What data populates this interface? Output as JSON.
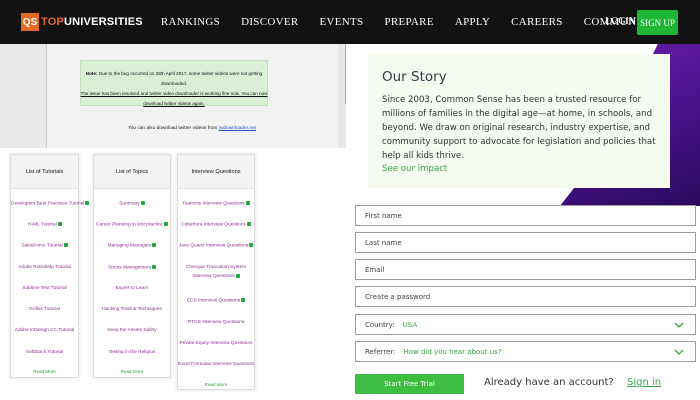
{
  "navbar": {
    "logo_box": "QS",
    "logo_text_prefix": "TOP",
    "logo_text_suffix": "UNIVERSITIES",
    "links": [
      "RANKINGS",
      "DISCOVER",
      "EVENTS",
      "PREPARE",
      "APPLY",
      "CAREERS",
      "COMMUNITY"
    ],
    "login": "LOGIN",
    "signup": "SIGN UP"
  },
  "notice": {
    "note_label": "Note:",
    "note_line1": "Due to the bug occurred on 28th April 2017, some twitter videos were not getting downloaded.",
    "note_line2": "The issue has been resolved and twitter video downloader is working fine now. You can now",
    "note_line3": "download twitter videos again.",
    "also_text": "You can also download twitter videos from",
    "also_link": "twdownloader.net"
  },
  "columns": [
    {
      "title": "List of Tutorials",
      "items": [
        {
          "label": "Developers Best Practices Tutorial",
          "badge": true
        },
        {
          "label": "YAML Tutorial",
          "badge": true
        },
        {
          "label": "SalesForce Tutorial",
          "badge": true
        },
        {
          "label": "Adobe Robohelp Tutorial",
          "badge": false
        },
        {
          "label": "Sublime Text Tutorial",
          "badge": false
        },
        {
          "label": "Grilles Tutorial",
          "badge": false
        },
        {
          "label": "Adobe InDesign CC Tutorial",
          "badge": false
        },
        {
          "label": "SaltStack Tutorial",
          "badge": false
        }
      ],
      "read_more": "Read More"
    },
    {
      "title": "List of Topics",
      "items": [
        {
          "label": "Summary",
          "badge": true
        },
        {
          "label": "Career Planning in test practice",
          "badge": true
        },
        {
          "label": "Managing Managers",
          "badge": true
        },
        {
          "label": "Stress Management",
          "badge": true
        },
        {
          "label": "Expert to Learn",
          "badge": false
        },
        {
          "label": "Hacking Tools & Techniques",
          "badge": false
        },
        {
          "label": "Keep the Assets Safely",
          "badge": false
        },
        {
          "label": "Testing in the Religion",
          "badge": false
        }
      ],
      "read_more": "Read More"
    },
    {
      "title": "Interview Questions",
      "items": [
        {
          "label": "Teamcity Interview Questions",
          "badge": true
        },
        {
          "label": "Cobertura Interview Questions",
          "badge": true
        },
        {
          "label": "Java Quartz Interview Questions",
          "badge": true
        },
        {
          "label": "Checque Truncation System Interview Questions",
          "badge": true
        },
        {
          "label": "ECS Interview Questions",
          "badge": true
        },
        {
          "label": "RTGS Interview Questions",
          "badge": false
        },
        {
          "label": "Private Equity Interview Questions",
          "badge": false
        },
        {
          "label": "Excel Formulas Interview Questions",
          "badge": false
        }
      ],
      "read_more": "Read More"
    }
  ],
  "story": {
    "title": "Our Story",
    "body": "Since 2003, Common Sense has been a trusted resource for millions of families in the digital age—at home, in schools, and beyond. We draw on original research, industry expertise, and community support to advocate for legislation and policies that help all kids thrive.",
    "link": "See our impact"
  },
  "form": {
    "first_name": "First name",
    "last_name": "Last name",
    "email": "Email",
    "password": "Create a password",
    "country_label": "Country:",
    "country_value": "USA",
    "referrer_label": "Referrer:",
    "referrer_value": "How did you hear about us?",
    "submit": "Start Free Trial",
    "already": "Already have an account?",
    "signin": "Sign in"
  },
  "colors": {
    "brand_orange": "#e56a25",
    "signup_green": "#1fb536",
    "accent_green": "#39a34a",
    "link_purple": "#8a2f8f"
  }
}
